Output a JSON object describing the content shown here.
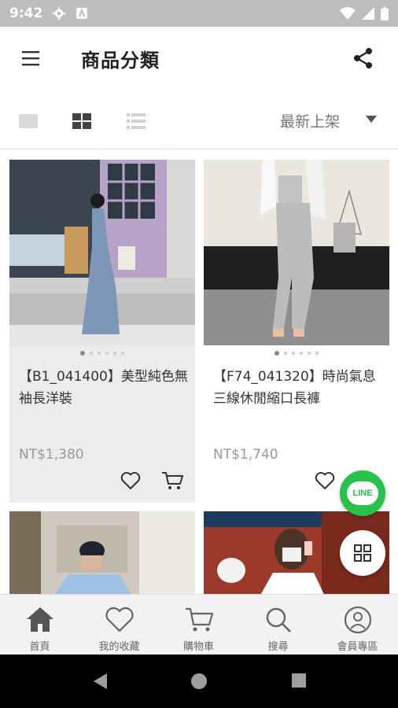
{
  "status_bar": {
    "time": "9:42"
  },
  "app_bar": {
    "title": "商品分類"
  },
  "toolbar": {
    "sort_label": "最新上架"
  },
  "products": [
    {
      "name": "【B1_041400】美型純色無袖長洋裝",
      "price": "NT$1,380",
      "bg": "#ececec"
    },
    {
      "name": "【F74_041320】時尚氣息三線休閒縮口長褲",
      "price": "NT$1,740",
      "bg": "#ffffff"
    }
  ],
  "fab": {
    "line_label": "LINE",
    "line_color": "#27c14b"
  },
  "bottom_nav": [
    {
      "label": "首頁",
      "icon": "home-icon",
      "active": true
    },
    {
      "label": "我的收藏",
      "icon": "heart-icon"
    },
    {
      "label": "購物車",
      "icon": "cart-icon"
    },
    {
      "label": "搜尋",
      "icon": "search-icon"
    },
    {
      "label": "會員專區",
      "icon": "user-icon"
    }
  ]
}
